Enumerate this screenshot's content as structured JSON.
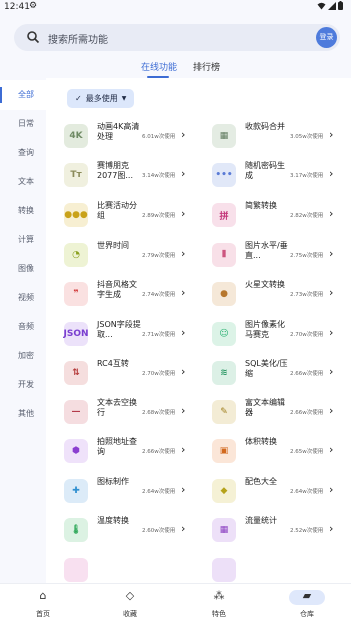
{
  "status": {
    "time": "12:41"
  },
  "search": {
    "placeholder": "搜索所需功能",
    "button": "登录"
  },
  "tabs": [
    {
      "label": "在线功能"
    },
    {
      "label": "排行榜"
    }
  ],
  "sidebar": [
    {
      "label": "全部"
    },
    {
      "label": "日常"
    },
    {
      "label": "查询"
    },
    {
      "label": "文本"
    },
    {
      "label": "转换"
    },
    {
      "label": "计算"
    },
    {
      "label": "图像"
    },
    {
      "label": "视频"
    },
    {
      "label": "音频"
    },
    {
      "label": "加密"
    },
    {
      "label": "开发"
    },
    {
      "label": "其他"
    }
  ],
  "filter": {
    "label": "最多使用"
  },
  "tools": [
    {
      "name": "动画4K高清处理",
      "uses": "6.01w次使用",
      "icon": "4K",
      "icon_name": "4k-icon",
      "color": "#6f8a64",
      "bg": "#e3ebde"
    },
    {
      "name": "收款码合并",
      "uses": "3.05w次使用",
      "icon": "▦",
      "icon_name": "qr-merge-icon",
      "color": "#5f7a5e",
      "bg": "#e4ece3"
    },
    {
      "name": "赛博朋克2077图...",
      "uses": "3.14w次使用",
      "icon": "Tт",
      "icon_name": "text-style-icon",
      "color": "#8a8a5a",
      "bg": "#f0f0df"
    },
    {
      "name": "随机密码生成",
      "uses": "3.17w次使用",
      "icon": "•••",
      "icon_name": "password-icon",
      "color": "#5a7bd6",
      "bg": "#e1e8f8"
    },
    {
      "name": "比赛活动分组",
      "uses": "2.89w次使用",
      "icon": "●●●",
      "icon_name": "group-icon",
      "color": "#c9a21a",
      "bg": "#f7efd2"
    },
    {
      "name": "简繁转换",
      "uses": "2.82w次使用",
      "icon": "拼",
      "icon_name": "pinyin-icon",
      "color": "#c4377a",
      "bg": "#f8e0ea"
    },
    {
      "name": "世界时间",
      "uses": "2.79w次使用",
      "icon": "◔",
      "icon_name": "clock-icon",
      "color": "#8aa01e",
      "bg": "#eef3d4"
    },
    {
      "name": "图片水平/垂直...",
      "uses": "2.75w次使用",
      "icon": "⫴",
      "icon_name": "image-flip-icon",
      "color": "#c43a6a",
      "bg": "#f8e0e8"
    },
    {
      "name": "抖音风格文字生成",
      "uses": "2.74w次使用",
      "icon": "❞",
      "icon_name": "quote-icon",
      "color": "#d23a3a",
      "bg": "#fae1e1"
    },
    {
      "name": "火星文转换",
      "uses": "2.73w次使用",
      "icon": "●",
      "icon_name": "egg-icon",
      "color": "#b7772d",
      "bg": "#f5e8d8"
    },
    {
      "name": "JSON字段提取...",
      "uses": "2.71w次使用",
      "icon": "JSON",
      "icon_name": "json-icon",
      "color": "#7a3fd0",
      "bg": "#ece2fa"
    },
    {
      "name": "图片像素化马赛克",
      "uses": "2.70w次使用",
      "icon": "☺",
      "icon_name": "pixel-face-icon",
      "color": "#27b070",
      "bg": "#dcf3e7"
    },
    {
      "name": "RC4互转",
      "uses": "2.70w次使用",
      "icon": "⇅",
      "icon_name": "swap-icon",
      "color": "#b43a3a",
      "bg": "#f5dede"
    },
    {
      "name": "SQL美化/压缩",
      "uses": "2.66w次使用",
      "icon": "≋",
      "icon_name": "database-icon",
      "color": "#2f9a68",
      "bg": "#dcf0e6"
    },
    {
      "name": "文本去空换行",
      "uses": "2.68w次使用",
      "icon": "—",
      "icon_name": "remove-line-icon",
      "color": "#b43a4a",
      "bg": "#f5dde0"
    },
    {
      "name": "富文本编辑器",
      "uses": "2.66w次使用",
      "icon": "✎",
      "icon_name": "edit-icon",
      "color": "#a08020",
      "bg": "#f3ecd5"
    },
    {
      "name": "拍照地址查询",
      "uses": "2.66w次使用",
      "icon": "⬢",
      "icon_name": "location-icon",
      "color": "#8b3fd0",
      "bg": "#efe2fa"
    },
    {
      "name": "体积转换",
      "uses": "2.65w次使用",
      "icon": "▣",
      "icon_name": "box-icon",
      "color": "#d2691e",
      "bg": "#fbe6d8"
    },
    {
      "name": "图标制作",
      "uses": "2.64w次使用",
      "icon": "✚",
      "icon_name": "icon-maker-icon",
      "color": "#2f8fd0",
      "bg": "#dcebf8"
    },
    {
      "name": "配色大全",
      "uses": "2.64w次使用",
      "icon": "◆",
      "icon_name": "palette-icon",
      "color": "#b5a21a",
      "bg": "#f5f1d5"
    },
    {
      "name": "温度转换",
      "uses": "2.60w次使用",
      "icon": "🌡",
      "icon_name": "thermometer-icon",
      "color": "#2fa85a",
      "bg": "#dcf2e3"
    },
    {
      "name": "流量统计",
      "uses": "2.52w次使用",
      "icon": "▦",
      "icon_name": "stats-icon",
      "color": "#8a3fc0",
      "bg": "#ede0f8"
    },
    {
      "name": "",
      "uses": "",
      "icon": "",
      "icon_name": "partial-icon",
      "color": "#c43a9a",
      "bg": "#f8e0f0"
    },
    {
      "name": "",
      "uses": "",
      "icon": "",
      "icon_name": "partial-icon",
      "color": "#8a3fc0",
      "bg": "#ede0f8"
    }
  ],
  "nav": [
    {
      "label": "首页",
      "icon": "⌂"
    },
    {
      "label": "收藏",
      "icon": "◇"
    },
    {
      "label": "特色",
      "icon": "⁂"
    },
    {
      "label": "仓库",
      "icon": "▰"
    }
  ]
}
